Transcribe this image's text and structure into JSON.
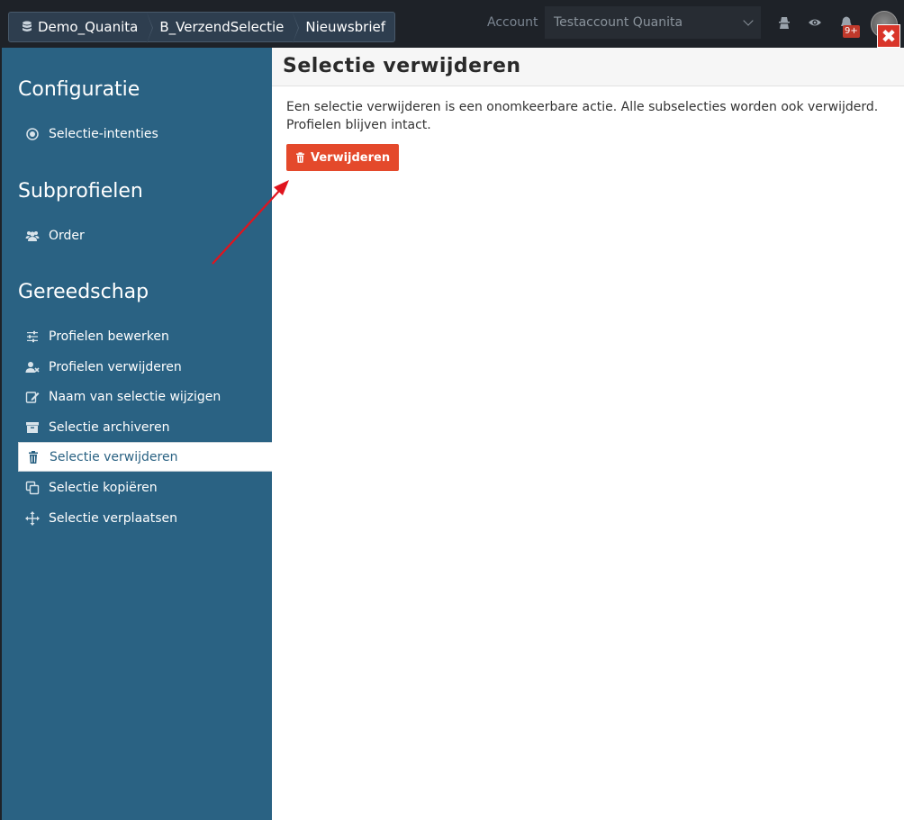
{
  "breadcrumb": [
    "Demo_Quanita",
    "B_VerzendSelectie",
    "Nieuwsbrief"
  ],
  "account": {
    "label": "Account",
    "selected": "Testaccount Quanita"
  },
  "notifications": {
    "badge": "9+"
  },
  "sidebar": {
    "sections": [
      {
        "title": "Configuratie",
        "items": [
          {
            "label": "Selectie-intenties",
            "icon": "target-icon"
          }
        ]
      },
      {
        "title": "Subprofielen",
        "items": [
          {
            "label": "Order",
            "icon": "users-icon"
          }
        ]
      },
      {
        "title": "Gereedschap",
        "items": [
          {
            "label": "Profielen bewerken",
            "icon": "sliders-icon"
          },
          {
            "label": "Profielen verwijderen",
            "icon": "user-remove-icon"
          },
          {
            "label": "Naam van selectie wijzigen",
            "icon": "edit-icon"
          },
          {
            "label": "Selectie archiveren",
            "icon": "archive-icon"
          },
          {
            "label": "Selectie verwijderen",
            "icon": "trash-icon",
            "active": true
          },
          {
            "label": "Selectie kopiëren",
            "icon": "copy-icon"
          },
          {
            "label": "Selectie verplaatsen",
            "icon": "move-icon"
          }
        ]
      }
    ]
  },
  "main": {
    "title": "Selectie verwijderen",
    "description": "Een selectie verwijderen is een onomkeerbare actie. Alle subselecties worden ook verwijderd. Profielen blijven intact.",
    "button_label": "Verwijderen"
  },
  "colors": {
    "sidebar": "#2a6283",
    "danger": "#e4492b",
    "topbar": "#1e2228",
    "annotation_arrow": "#e0141e"
  }
}
